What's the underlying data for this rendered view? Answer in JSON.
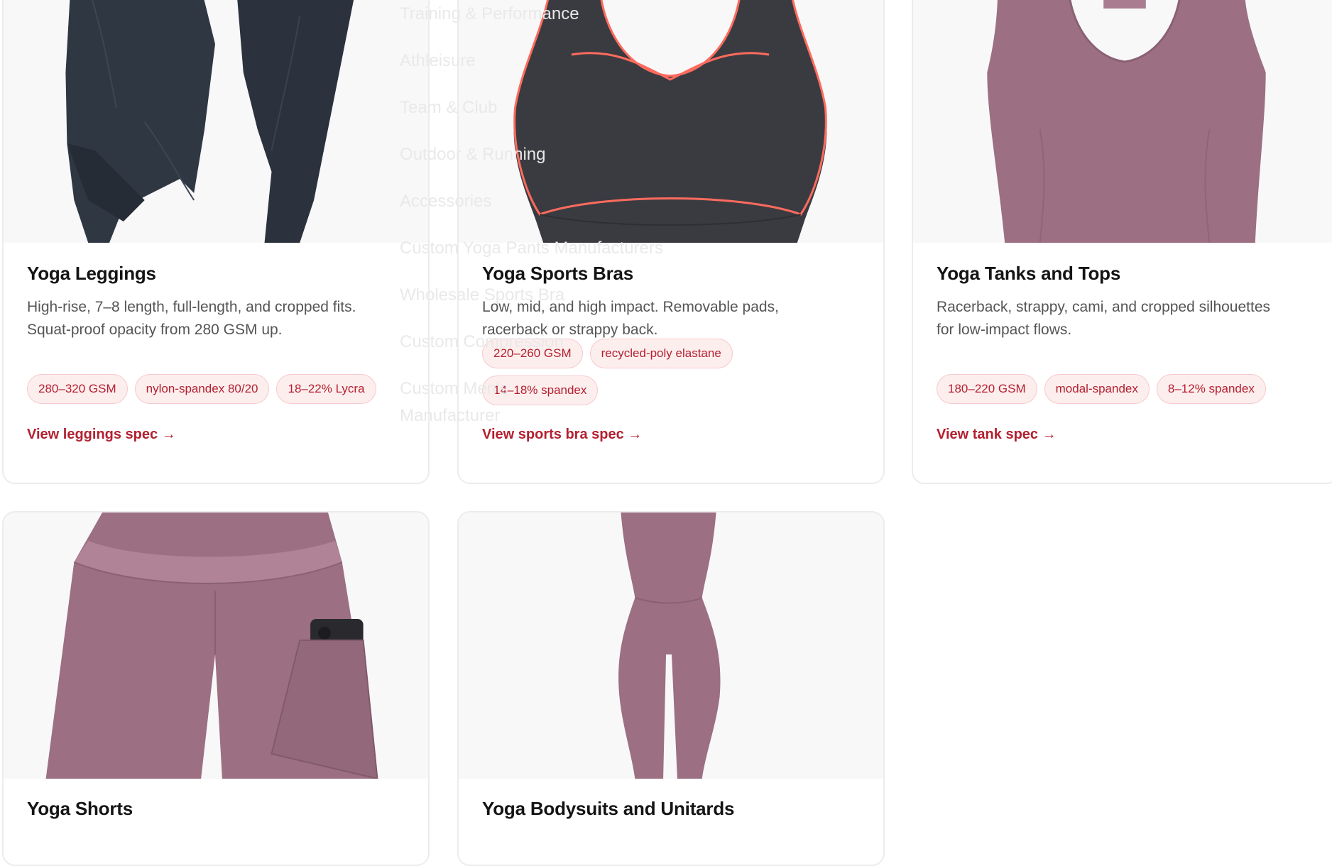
{
  "ghost_menu": [
    "Training & Performance",
    "Athleisure",
    "Team & Club",
    "Outdoor & Running",
    "Accessories",
    "Custom Yoga Pants Manufacturers",
    "Wholesale Sports Bra",
    "Custom Compression",
    "Custom Men's",
    "Manufacturer"
  ],
  "cards": [
    {
      "title": "Yoga Leggings",
      "desc_line1": "High-rise, 7–8 length, full-length, and cropped fits.",
      "desc_line2": "Squat-proof opacity from 280 GSM up.",
      "chips": [
        "280–320 GSM",
        "nylon-spandex 80/20",
        "18–22% Lycra"
      ],
      "link": "View leggings spec →"
    },
    {
      "title": "Yoga Sports Bras",
      "desc_line1": "Low, mid, and high impact. Removable pads,",
      "desc_line2": "racerback or strappy back.",
      "chips": [
        "220–260 GSM",
        "recycled-poly elastane",
        "14–18% spandex"
      ],
      "link": "View sports bra spec →"
    },
    {
      "title": "Yoga Tanks and Tops",
      "desc_line1": "Racerback, strappy, cami, and cropped silhouettes",
      "desc_line2": "for low-impact flows.",
      "chips": [
        "180–220 GSM",
        "modal-spandex",
        "8–12% spandex"
      ],
      "link": "View tank spec →"
    },
    {
      "title": "Yoga Shorts"
    },
    {
      "title": "Yoga Bodysuits and Unitards"
    }
  ],
  "colors": {
    "accent": "#b3202f",
    "chip_bg": "#fdeeee",
    "border": "#ececec",
    "navy": "#2d3440",
    "charcoal": "#3a3b40",
    "mauve": "#9c6f82"
  }
}
